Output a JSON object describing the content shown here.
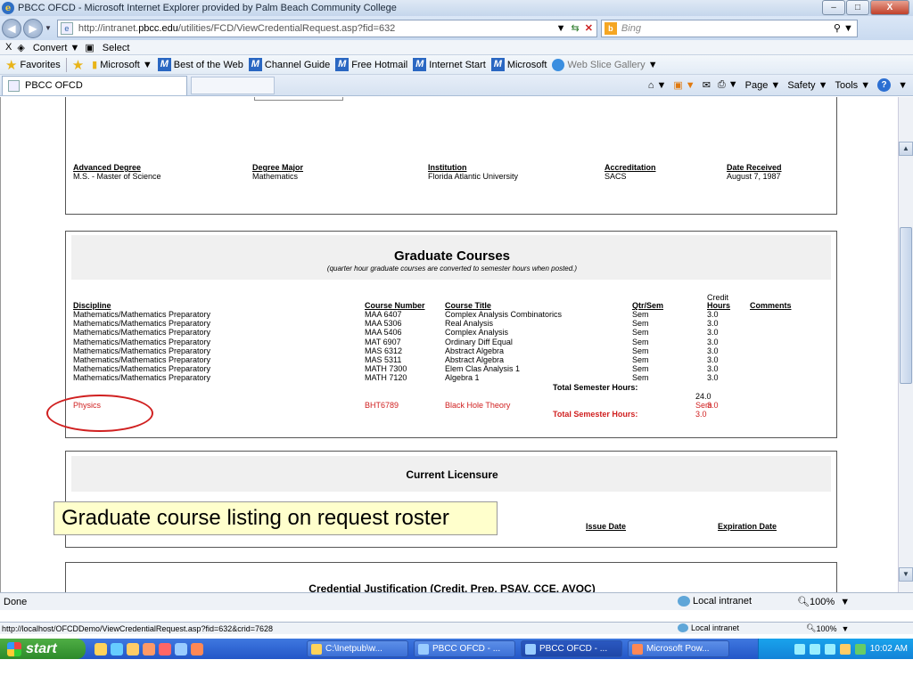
{
  "window": {
    "title": "PBCC OFCD - Microsoft Internet Explorer provided by Palm Beach Community College",
    "minimize_glyph": "–",
    "maximize_glyph": "□",
    "close_glyph": "X"
  },
  "address": {
    "url_prefix": "http://intranet.",
    "url_domain": "pbcc.edu",
    "url_path": "/utilities/FCD/ViewCredentialRequest.asp?fid=632",
    "search_placeholder": "Bing"
  },
  "convert_bar": {
    "close": "X",
    "convert": "Convert",
    "select": "Select"
  },
  "favorites": {
    "label": "Favorites",
    "items": [
      "Microsoft",
      "Best of the Web",
      "Channel Guide",
      "Free Hotmail",
      "Internet Start",
      "Microsoft",
      "Web Slice Gallery"
    ]
  },
  "tab": {
    "label": "PBCC OFCD"
  },
  "command_bar": {
    "page": "Page",
    "safety": "Safety",
    "tools": "Tools",
    "help": "?"
  },
  "degree": {
    "headers": [
      "Advanced Degree",
      "Degree Major",
      "Institution",
      "Accreditation",
      "Date Received"
    ],
    "values": [
      "M.S. - Master of Science",
      "Mathematics",
      "Florida Atlantic University",
      "SACS",
      "August 7, 1987"
    ]
  },
  "graduate_courses": {
    "title": "Graduate Courses",
    "subtitle": "(quarter hour graduate courses are converted to semester hours when posted.)",
    "headers": {
      "discipline": "Discipline",
      "course_number": "Course Number",
      "course_title": "Course Title",
      "qtr_sem": "Qtr/Sem",
      "credit": "Credit",
      "hours": "Hours",
      "comments": "Comments"
    },
    "rows": [
      {
        "discipline": "Mathematics/Mathematics Preparatory",
        "number": "MAA 6407",
        "title": "Complex Analysis Combinatorics",
        "qs": "Sem",
        "hours": "3.0"
      },
      {
        "discipline": "Mathematics/Mathematics Preparatory",
        "number": "MAA 5306",
        "title": "Real Analysis",
        "qs": "Sem",
        "hours": "3.0"
      },
      {
        "discipline": "Mathematics/Mathematics Preparatory",
        "number": "MAA 5406",
        "title": "Complex Analysis",
        "qs": "Sem",
        "hours": "3.0"
      },
      {
        "discipline": "Mathematics/Mathematics Preparatory",
        "number": "MAT 6907",
        "title": "Ordinary Diff Equal",
        "qs": "Sem",
        "hours": "3.0"
      },
      {
        "discipline": "Mathematics/Mathematics Preparatory",
        "number": "MAS 6312",
        "title": "Abstract Algebra",
        "qs": "Sem",
        "hours": "3.0"
      },
      {
        "discipline": "Mathematics/Mathematics Preparatory",
        "number": "MAS 5311",
        "title": "Abstract Algebra",
        "qs": "Sem",
        "hours": "3.0"
      },
      {
        "discipline": "Mathematics/Mathematics Preparatory",
        "number": "MATH 7300",
        "title": "Elem Clas Analysis 1",
        "qs": "Sem",
        "hours": "3.0"
      },
      {
        "discipline": "Mathematics/Mathematics Preparatory",
        "number": "MATH 7120",
        "title": "Algebra 1",
        "qs": "Sem",
        "hours": "3.0"
      }
    ],
    "total_label": "Total Semester Hours:",
    "total_value": "24.0",
    "physics": {
      "discipline": "Physics",
      "number": "BHT6789",
      "title": "Black Hole Theory",
      "qs": "Sem",
      "hours": "3.0"
    },
    "physics_total_label": "Total Semester Hours:",
    "physics_total_value": "3.0"
  },
  "licensure": {
    "title": "Current Licensure",
    "issue_date": "Issue Date",
    "expiration_date": "Expiration Date"
  },
  "justification_title": "Credential Justification (Credit, Prep, PSAV, CCE, AVOC)",
  "callout": "Graduate course listing on request roster",
  "status": {
    "done": "Done",
    "zone": "Local intranet",
    "zoom": "100%",
    "hover_url": "http://localhost/OFCDDemo/ViewCredentialRequest.asp?fid=632&crid=7628",
    "zone2": "Local intranet",
    "zoom2": "100%"
  },
  "taskbar": {
    "start": "start",
    "buttons": [
      "C:\\Inetpub\\w...",
      "PBCC OFCD - ...",
      "PBCC OFCD - ...",
      "Microsoft Pow..."
    ],
    "clock": "10:02 AM"
  },
  "colors": {
    "highlight_red": "#d02020",
    "callout_bg": "#ffffcc"
  }
}
